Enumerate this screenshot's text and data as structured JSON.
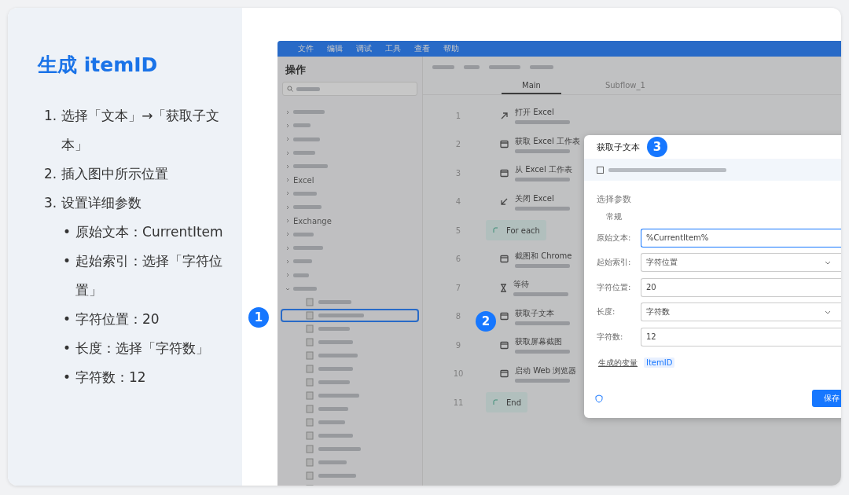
{
  "lesson": {
    "title": "生成 itemID",
    "steps": [
      {
        "marker": "1.",
        "text": "选择「文本」→「获取子文本」"
      },
      {
        "marker": "2.",
        "text": "插入图中所示位置"
      },
      {
        "marker": "3.",
        "text": "设置详细参数",
        "children": [
          {
            "marker": "•",
            "text": "原始文本：CurrentItem"
          },
          {
            "marker": "•",
            "text": "起始索引：选择「字符位置」"
          },
          {
            "marker": "•",
            "text": "字符位置：20"
          },
          {
            "marker": "•",
            "text": "长度：选择「字符数」"
          },
          {
            "marker": "•",
            "text": "字符数：12"
          }
        ]
      }
    ]
  },
  "screenshot": {
    "menu": [
      "文件",
      "编辑",
      "调试",
      "工具",
      "查看",
      "帮助"
    ],
    "sidebar": {
      "title": "操作",
      "groups": [
        {
          "expanded": false
        },
        {
          "expanded": false
        },
        {
          "expanded": false
        },
        {
          "expanded": false
        },
        {
          "expanded": false
        },
        {
          "expanded": false,
          "label": "Excel"
        },
        {
          "expanded": false
        },
        {
          "expanded": false
        },
        {
          "expanded": false,
          "label": "Exchange"
        },
        {
          "expanded": false
        },
        {
          "expanded": false
        },
        {
          "expanded": false
        },
        {
          "expanded": false
        },
        {
          "expanded": true,
          "children": [
            {
              "selected": false
            },
            {
              "selected": true
            },
            {
              "selected": false
            },
            {
              "selected": false
            },
            {
              "selected": false
            },
            {
              "selected": false
            },
            {
              "selected": false
            },
            {
              "selected": false
            },
            {
              "selected": false
            },
            {
              "selected": false
            },
            {
              "selected": false
            },
            {
              "selected": false
            },
            {
              "selected": false
            },
            {
              "selected": false
            },
            {
              "selected": false
            }
          ]
        }
      ]
    },
    "tabs": [
      {
        "label": "Main",
        "selected": true
      },
      {
        "label": "Subflow_1",
        "selected": false
      }
    ],
    "steps": [
      {
        "line": "1",
        "kind": "action",
        "title": "打开 Excel"
      },
      {
        "line": "2",
        "kind": "action",
        "title": "获取 Excel 工作表"
      },
      {
        "line": "3",
        "kind": "action",
        "title": "从 Excel 工作表"
      },
      {
        "line": "4",
        "kind": "action",
        "title": "关闭 Excel"
      },
      {
        "line": "5",
        "kind": "loop",
        "title": "For each"
      },
      {
        "line": "6",
        "kind": "action",
        "title": "截图和 Chrome"
      },
      {
        "line": "7",
        "kind": "action",
        "title": "等待"
      },
      {
        "line": "8",
        "kind": "action",
        "title": "获取子文本"
      },
      {
        "line": "9",
        "kind": "action",
        "title": "获取屏幕截图"
      },
      {
        "line": "10",
        "kind": "action",
        "title": "启动 Web 浏览器"
      },
      {
        "line": "11",
        "kind": "end",
        "title": "End"
      }
    ],
    "dialog": {
      "title": "获取子文本",
      "section": "选择参数",
      "group": "常规",
      "fields": [
        {
          "label": "原始文本:",
          "value": "%CurrentItem%",
          "kind": "input",
          "focused": true
        },
        {
          "label": "起始索引:",
          "value": "字符位置",
          "kind": "select",
          "focused": false
        },
        {
          "label": "字符位置:",
          "value": "20",
          "kind": "input",
          "focused": false
        },
        {
          "label": "长度:",
          "value": "字符数",
          "kind": "select",
          "focused": false
        },
        {
          "label": "字符数:",
          "value": "12",
          "kind": "input",
          "focused": false
        }
      ],
      "output_label": "生成的变量",
      "output_var": "ItemID",
      "save": "保存"
    },
    "badges": [
      "1",
      "2",
      "3"
    ]
  }
}
